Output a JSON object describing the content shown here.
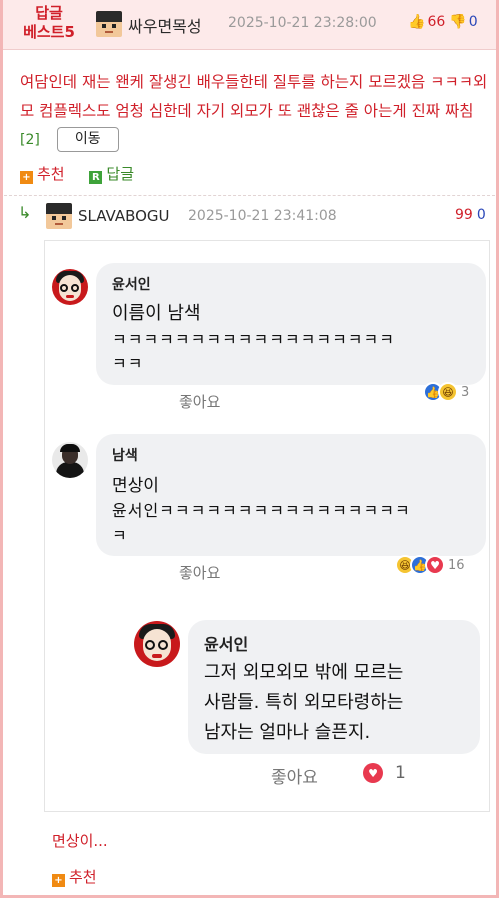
{
  "best_comment": {
    "badge_line1": "답글",
    "badge_line2": "베스트5",
    "author": "싸우면목성",
    "date": "2025-10-21 23:28:00",
    "upvotes": "66",
    "downvotes": "0",
    "text": "여담인데 재는 왠케 잘생긴 배우들한테 질투를 하는지 모르겠음 ㅋㅋㅋ외모 컴플렉스도 엄청 심한데 자기 외모가 또 괜찮은 줄 아는게 진짜 짜침",
    "ref_count": "[2]",
    "move_button": "이동",
    "recommend_label": "추천",
    "recommend_icon": "+",
    "reply_label": "답글",
    "reply_icon": "R"
  },
  "reply": {
    "author": "SLAVABOGU",
    "date": "2025-10-21 23:41:08",
    "upvotes": "99",
    "downvotes": "0",
    "text": "면상이...",
    "recommend_label": "추천",
    "recommend_icon": "+",
    "reply_arrow": "↳"
  },
  "embedded_comments": [
    {
      "name": "윤서인",
      "line1": "이름이 남색",
      "line2": "ㅋㅋㅋㅋㅋㅋㅋㅋㅋㅋㅋㅋㅋㅋㅋㅋㅋㅋ",
      "line3": "ㅋㅋ",
      "like_label": "좋아요",
      "reaction_count": "3"
    },
    {
      "name": "남색",
      "line1": "면상이",
      "line2": "윤서인ㅋㅋㅋㅋㅋㅋㅋㅋㅋㅋㅋㅋㅋㅋㅋㅋ",
      "line3": "ㅋ",
      "like_label": "좋아요",
      "reaction_count": "16"
    },
    {
      "name": "윤서인",
      "line1": "그저 외모외모 밖에 모르는",
      "line2": "사람들. 특히 외모타령하는",
      "line3": "남자는 얼마나 슬픈지.",
      "like_label": "좋아요",
      "reaction_count": "1"
    }
  ],
  "icons": {
    "thumb_up": "👍",
    "thumb_down": "👎",
    "like_reaction": "👍",
    "haha_reaction": "😆",
    "love_reaction": "♥"
  },
  "colors": {
    "accent_red": "#d0202a",
    "accent_green": "#3a8a2a",
    "accent_blue": "#2a47b8",
    "best_row_bg": "#fdeaea",
    "border_pink": "#f3b6b6"
  }
}
